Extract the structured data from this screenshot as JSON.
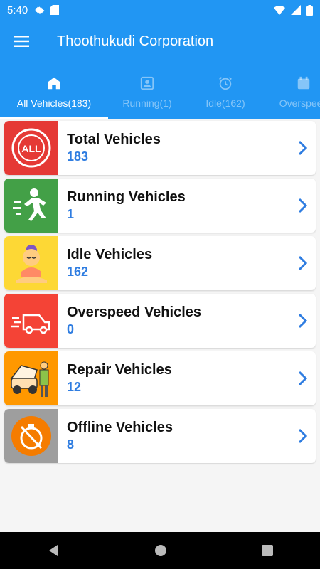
{
  "status_bar": {
    "time": "5:40"
  },
  "app_bar": {
    "title": "Thoothukudi Corporation"
  },
  "tabs": [
    {
      "label": "All Vehicles(183)"
    },
    {
      "label": "Running(1)"
    },
    {
      "label": "Idle(162)"
    },
    {
      "label": "Overspeed"
    }
  ],
  "vehicles": [
    {
      "label": "Total Vehicles",
      "count": "183",
      "badge": "ALL",
      "color": "#e53935"
    },
    {
      "label": "Running Vehicles",
      "count": "1",
      "color": "#43a047"
    },
    {
      "label": "Idle Vehicles",
      "count": "162",
      "color": "#fdd835"
    },
    {
      "label": "Overspeed Vehicles",
      "count": "0",
      "color": "#f44336"
    },
    {
      "label": "Repair Vehicles",
      "count": "12",
      "color": "#ff9800"
    },
    {
      "label": "Offline Vehicles",
      "count": "8",
      "color": "#9e9e9e"
    }
  ],
  "colors": {
    "primary": "#2196f3",
    "count_text": "#2f7de1"
  }
}
